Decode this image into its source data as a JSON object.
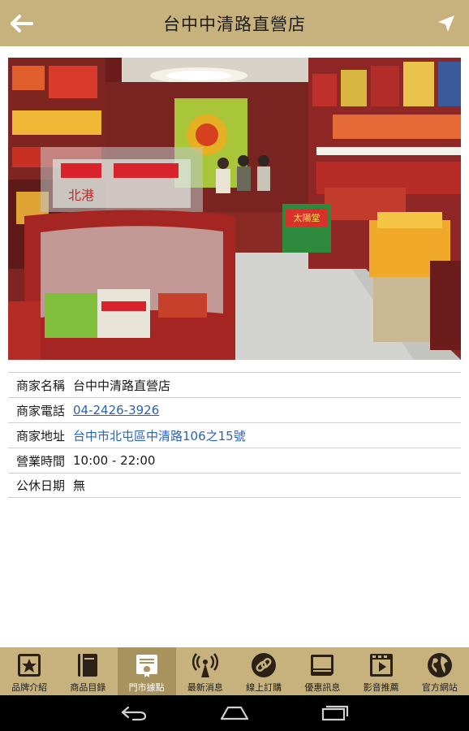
{
  "header": {
    "title": "台中中清路直營店"
  },
  "store_info": {
    "rows": [
      {
        "label": "商家名稱",
        "value": "台中中清路直營店"
      },
      {
        "label": "商家電話",
        "value": "04-2426-3926"
      },
      {
        "label": "商家地址",
        "value": "台中市北屯區中清路106之15號"
      },
      {
        "label": "營業時間",
        "value": "10:00 - 22:00"
      },
      {
        "label": "公休日期",
        "value": "無"
      }
    ]
  },
  "photo_signs": {
    "left_case": "北港",
    "right_cart": "太陽堂"
  },
  "tabs": [
    {
      "label": "品牌介紹",
      "icon": "star-frame-icon"
    },
    {
      "label": "商品目錄",
      "icon": "book-icon"
    },
    {
      "label": "門市據點",
      "icon": "certificate-icon",
      "active": true
    },
    {
      "label": "最新消息",
      "icon": "broadcast-icon"
    },
    {
      "label": "線上訂購",
      "icon": "link-icon"
    },
    {
      "label": "優惠訊息",
      "icon": "coupon-icon"
    },
    {
      "label": "影音推薦",
      "icon": "film-play-icon"
    },
    {
      "label": "官方網站",
      "icon": "globe-icon"
    }
  ],
  "colors": {
    "bar": "#c7b27e",
    "active_tab": "#a8935f",
    "link": "#2a62b9"
  }
}
